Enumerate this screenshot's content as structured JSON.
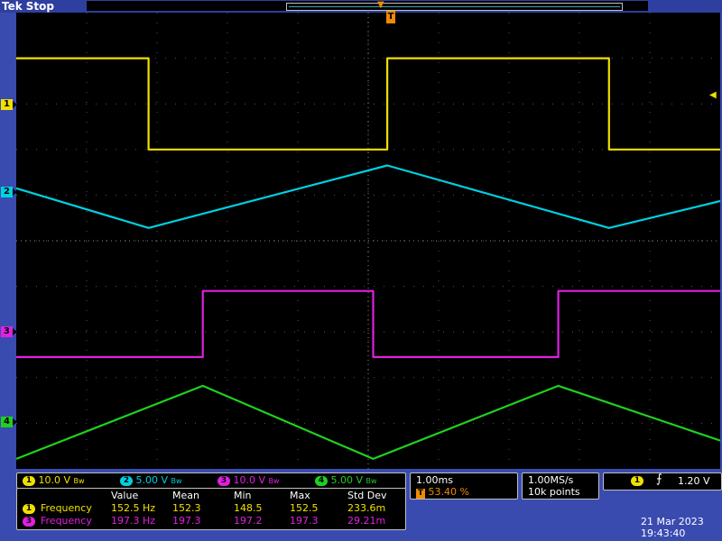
{
  "header": {
    "brand": "Tek",
    "state": "Stop"
  },
  "colors": {
    "ch1": "#f0e000",
    "ch2": "#00d0e0",
    "ch3": "#e020e0",
    "ch4": "#20d020",
    "trigger": "#f08a00",
    "screen_bg": "#000000",
    "frame_bg": "#3a4bb0"
  },
  "markers": {
    "ch1": "1",
    "ch2": "2",
    "ch3": "3",
    "ch4": "4",
    "trigger": "T"
  },
  "channel_scales": [
    {
      "ch": "1",
      "value": "10.0 V",
      "coupling": "Bw"
    },
    {
      "ch": "2",
      "value": "5.00 V",
      "coupling": "Bw"
    },
    {
      "ch": "3",
      "value": "10.0 V",
      "coupling": "Bw"
    },
    {
      "ch": "4",
      "value": "5.00 V",
      "coupling": "Bw"
    }
  ],
  "measurements": {
    "headers": [
      "Value",
      "Mean",
      "Min",
      "Max",
      "Std Dev"
    ],
    "rows": [
      {
        "ch": "1",
        "name": "Frequency",
        "value": "152.5 Hz",
        "mean": "152.3",
        "min": "148.5",
        "max": "152.5",
        "std": "233.6m"
      },
      {
        "ch": "3",
        "name": "Frequency",
        "value": "197.3 Hz",
        "mean": "197.3",
        "min": "197.2",
        "max": "197.3",
        "std": "29.21m"
      }
    ]
  },
  "timebase": {
    "scale": "1.00ms",
    "trigger_position": "53.40 %"
  },
  "acquisition": {
    "rate": "1.00MS/s",
    "length": "10k points"
  },
  "trigger": {
    "source": "1",
    "slope_icon": "rising-edge-icon",
    "level": "1.20 V"
  },
  "datetime": {
    "date": "21 Mar  2023",
    "time": "19:43:40"
  },
  "chart_data": {
    "type": "line",
    "x_unit": "ms",
    "xlim": [
      0,
      10
    ],
    "y_unit": "divisions",
    "ylim": [
      0,
      10
    ],
    "grid": true,
    "series": [
      {
        "name": "1",
        "color": "#f0e000",
        "shape": "square",
        "high": 9.0,
        "low": 7.0,
        "edges_ms": [
          [
            1.88,
            "fall"
          ],
          [
            5.27,
            "rise"
          ],
          [
            8.42,
            "fall"
          ]
        ],
        "start": "high"
      },
      {
        "name": "2",
        "color": "#00d0e0",
        "shape": "triangle",
        "points": [
          [
            0,
            6.15
          ],
          [
            1.88,
            5.28
          ],
          [
            5.27,
            6.65
          ],
          [
            8.42,
            5.28
          ],
          [
            10,
            5.87
          ]
        ]
      },
      {
        "name": "3",
        "color": "#e020e0",
        "shape": "square",
        "high": 3.9,
        "low": 2.45,
        "edges_ms": [
          [
            2.65,
            "rise"
          ],
          [
            5.07,
            "fall"
          ],
          [
            7.7,
            "rise"
          ]
        ],
        "start": "low"
      },
      {
        "name": "4",
        "color": "#20d020",
        "shape": "triangle",
        "points": [
          [
            0,
            0.22
          ],
          [
            2.65,
            1.82
          ],
          [
            5.07,
            0.22
          ],
          [
            7.7,
            1.82
          ],
          [
            10,
            0.62
          ]
        ]
      }
    ]
  }
}
